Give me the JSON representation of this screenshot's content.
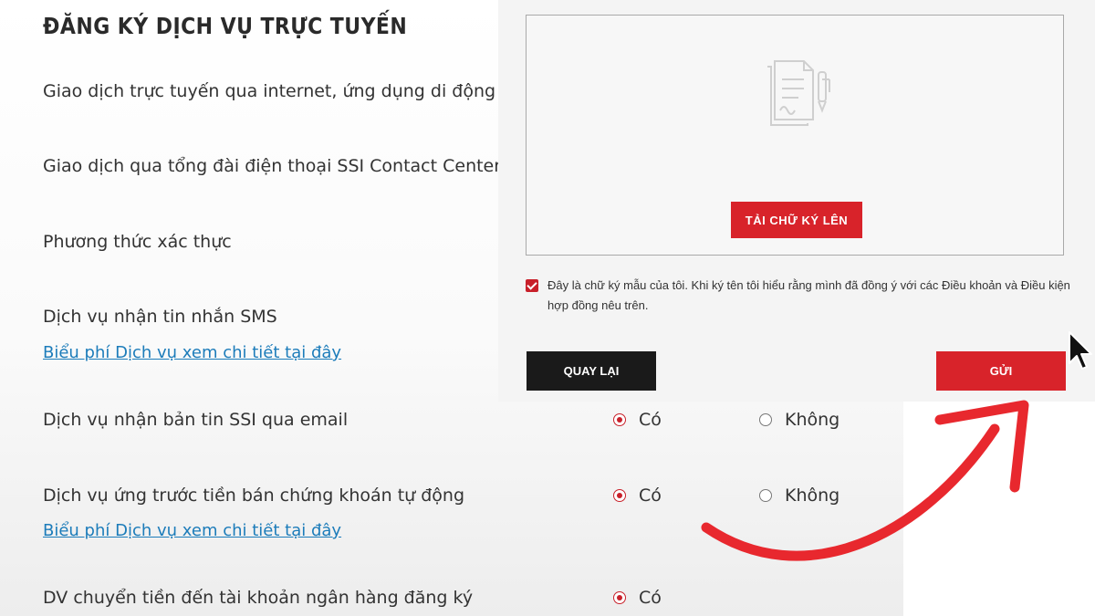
{
  "page": {
    "title": "ĐĂNG KÝ DỊCH VỤ TRỰC TUYẾN",
    "rows": [
      {
        "label": "Giao dịch trực tuyến qua internet, ứng dụng di động"
      },
      {
        "label": "Giao dịch qua tổng đài điện thoại SSI Contact Center"
      },
      {
        "label": "Phương thức xác thực"
      },
      {
        "label": "Dịch vụ nhận tin nhắn SMS",
        "link": "Biểu phí Dịch vụ xem chi tiết tại đây"
      },
      {
        "label": "Dịch vụ nhận bản tin SSI qua email",
        "options": [
          "Có",
          "Không"
        ],
        "selected": "Có"
      },
      {
        "label": "Dịch vụ ứng trước tiền bán chứng khoán tự động",
        "link": "Biểu phí Dịch vụ xem chi tiết tại đây",
        "options": [
          "Có",
          "Không"
        ],
        "selected": "Có"
      },
      {
        "label": "DV chuyển tiền đến tài khoản ngân hàng đăng ký",
        "options": [
          "Có"
        ],
        "selected": "Có"
      }
    ]
  },
  "modal": {
    "upload_label": "TẢI CHỮ KÝ LÊN",
    "consent_checked": true,
    "consent_text": "Đây là chữ ký mẫu của tôi. Khi ký tên tôi hiểu rằng mình đã đồng ý với các Điều khoản và Điều kiện hợp đồng nêu trên.",
    "back_label": "QUAY LẠI",
    "send_label": "GỬI"
  },
  "icons": {
    "signature_placeholder": "document-signature-icon",
    "pointer": "mouse-cursor-icon",
    "annotation": "curved-arrow-icon"
  },
  "colors": {
    "accent_red": "#d8232a",
    "link_blue": "#1c7cba",
    "dark_button": "#1a1a1a"
  }
}
